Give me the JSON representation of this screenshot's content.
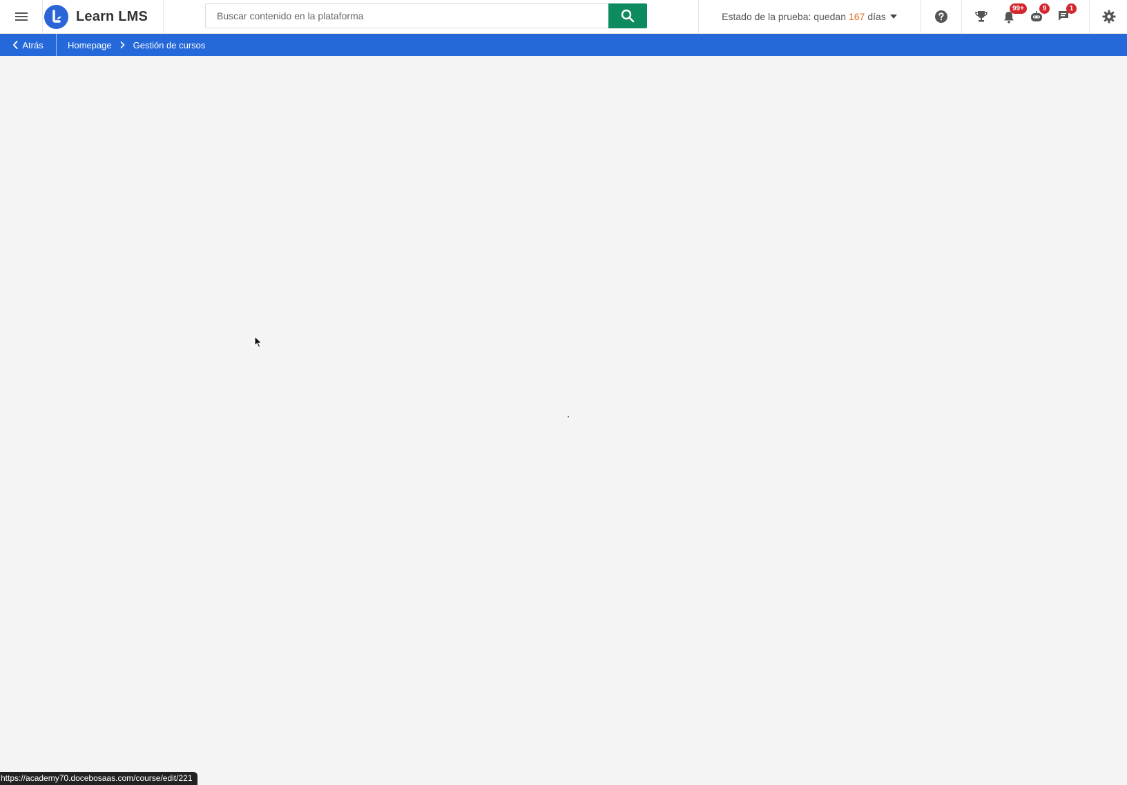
{
  "header": {
    "brand": "Learn LMS",
    "search": {
      "placeholder": "Buscar contenido en la plataforma",
      "value": ""
    },
    "trial": {
      "prefix": "Estado de la prueba: quedan",
      "days": "167",
      "suffix": "días"
    },
    "badges": {
      "notifications": "99+",
      "messages_bot": "9",
      "chat": "1"
    }
  },
  "subbar": {
    "back_label": "Atrás",
    "breadcrumb": [
      {
        "label": "Homepage"
      },
      {
        "label": "Gestión de cursos"
      }
    ]
  },
  "status_bar": {
    "url": "https://academy70.docebosaas.com/course/edit/221"
  },
  "colors": {
    "brand_blue": "#2468d9",
    "search_green": "#0e8a5f",
    "badge_red": "#d3262f",
    "trial_days_orange": "#e36b1b",
    "page_bg": "#f4f4f4"
  },
  "icons": {
    "menu": "hamburger-icon",
    "search": "search-icon",
    "help": "help-circle-icon",
    "trophy": "trophy-icon",
    "notifications": "bell-icon",
    "bot": "bot-icon",
    "chat": "chat-icon",
    "settings": "gear-icon",
    "back": "chevron-left-icon",
    "separator": "chevron-right-icon",
    "dropdown": "caret-down-icon"
  }
}
